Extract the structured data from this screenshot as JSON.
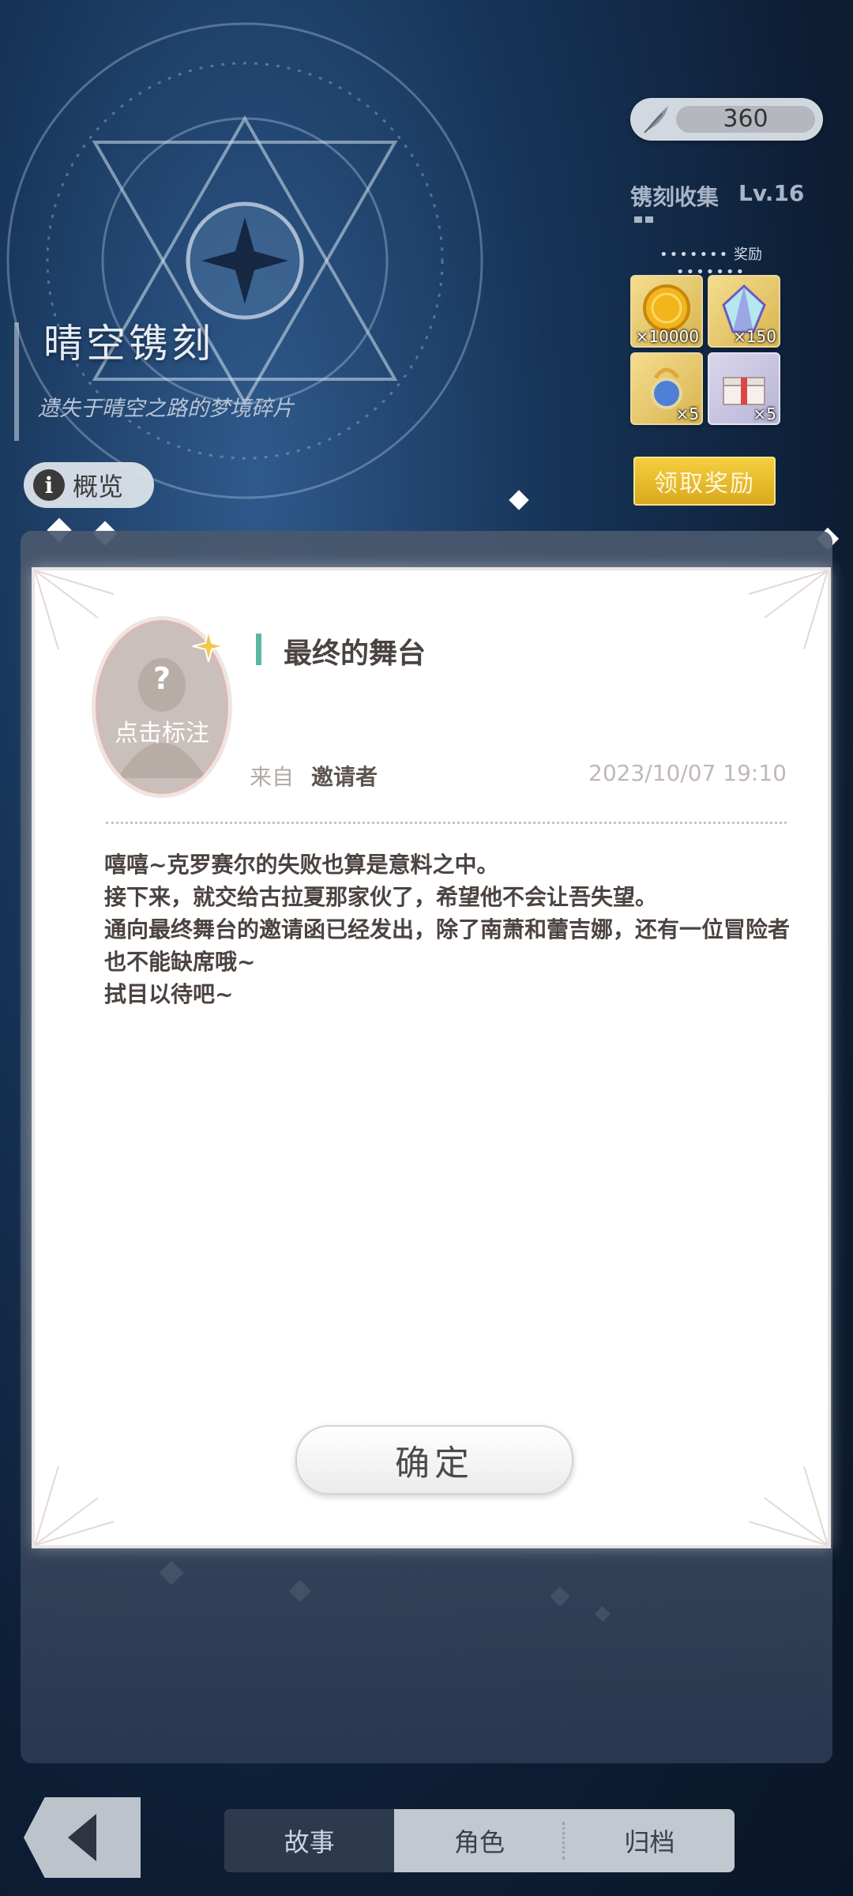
{
  "header": {
    "title": "晴空镌刻",
    "subtitle": "遗失于晴空之路的梦境碎片",
    "overview_label": "概览"
  },
  "currency": {
    "value": "360",
    "icon": "feather-icon"
  },
  "collection": {
    "title": "镌刻收集",
    "level": "Lv.16",
    "reward_label": "奖励",
    "rewards": [
      {
        "name": "gold-coin-icon",
        "qty": "×10000"
      },
      {
        "name": "crystal-icon",
        "qty": "×150"
      },
      {
        "name": "gem-charm-icon",
        "qty": "×5"
      },
      {
        "name": "gift-box-icon",
        "qty": "×5"
      }
    ],
    "claim_label": "领取奖励"
  },
  "mail": {
    "avatar_label": "点击标注",
    "title": "最终的舞台",
    "from_label": "来自",
    "from_value": "邀请者",
    "date": "2023/10/07  19:10",
    "body": [
      "嘻嘻~克罗赛尔的失败也算是意料之中。",
      "接下来，就交给古拉夏那家伙了，希望他不会让吾失望。",
      "通向最终舞台的邀请函已经发出，除了南萧和蕾吉娜，还有一位冒险者也不能缺席哦~",
      "拭目以待吧~"
    ],
    "confirm_label": "确定"
  },
  "tabs": [
    {
      "label": "故事",
      "active": true
    },
    {
      "label": "角色",
      "active": false
    },
    {
      "label": "归档",
      "active": false
    }
  ],
  "colors": {
    "accent_teal": "#58b8a4",
    "claim_gold": "#e8bc2c",
    "tab_active": "#2d3a4e"
  }
}
